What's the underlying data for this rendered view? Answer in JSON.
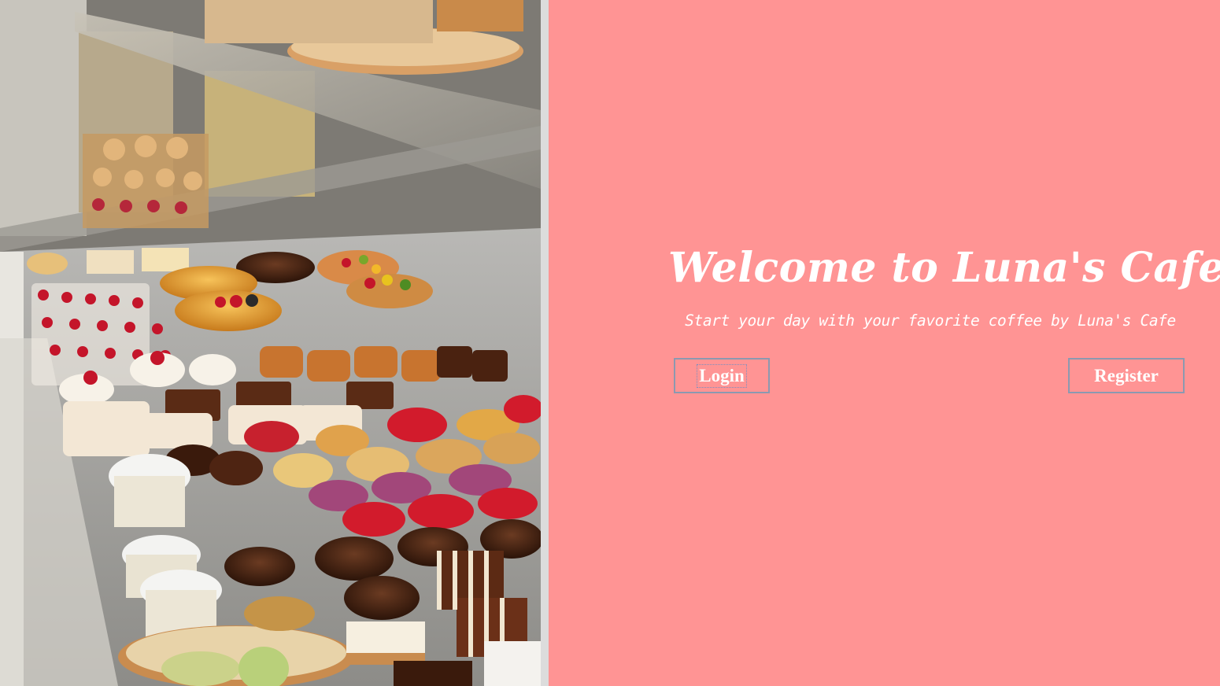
{
  "hero": {
    "title": "Welcome to Luna's Cafe",
    "subtitle": "Start your day with your favorite coffee by Luna's Cafe",
    "login_label": "Login",
    "register_label": "Register"
  },
  "photo": {
    "description_icon": "pastry-display-photo"
  },
  "colors": {
    "hero_background": "#ff9494",
    "text": "#ffffff",
    "button_border": "#8c99b0"
  }
}
